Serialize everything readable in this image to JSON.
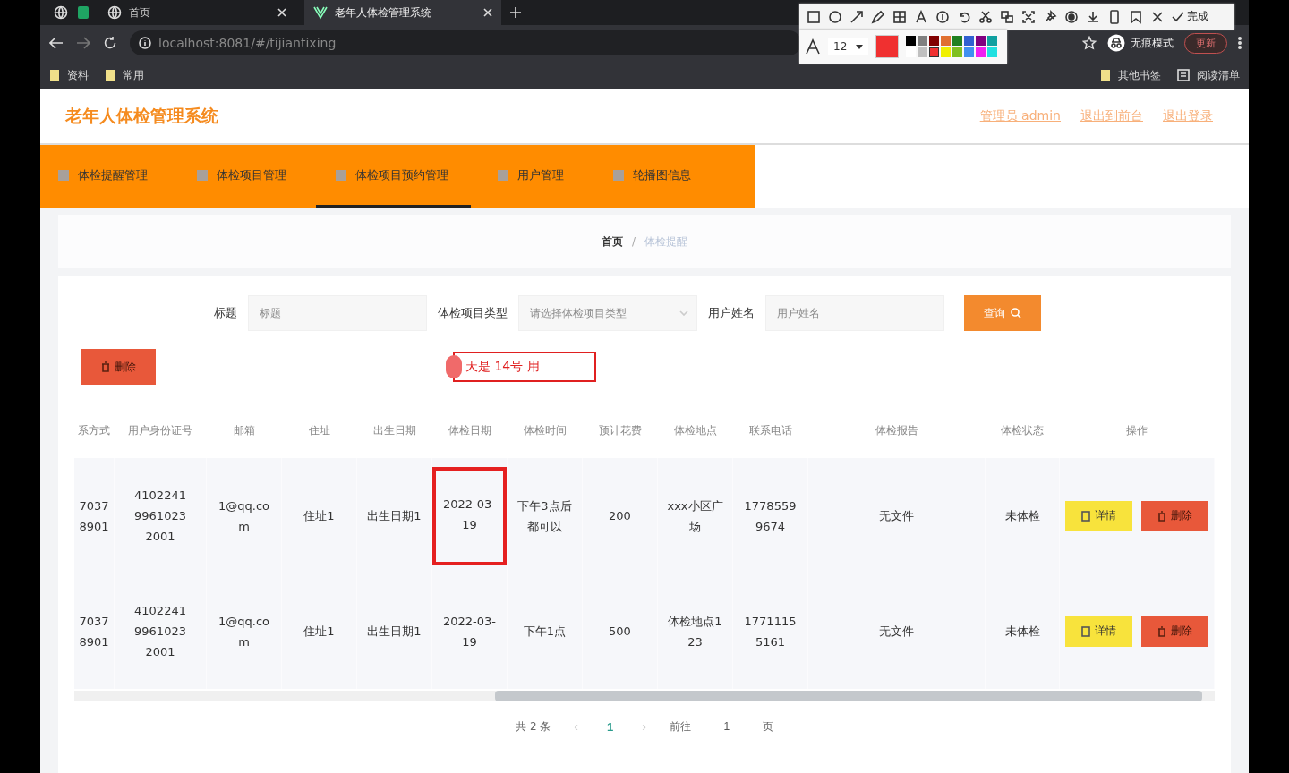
{
  "browser": {
    "tabs": [
      {
        "title": "首页",
        "selected": false
      },
      {
        "title": "老年人体检管理系统",
        "selected": true
      }
    ],
    "url": "localhost:8081/#/tijiantixing",
    "bookmarks": [
      "资料",
      "常用"
    ],
    "right_bookmarks": [
      "其他书签",
      "阅读清单"
    ],
    "incognito": "无痕模式",
    "update_button": "更新"
  },
  "annotation_toolbar": {
    "done": "完成",
    "font_size": "12",
    "swatches": [
      {
        "color": "#000000",
        "selected": false
      },
      {
        "color": "#808080",
        "selected": false
      },
      {
        "color": "#800000",
        "selected": false
      },
      {
        "color": "#e07030",
        "selected": false
      },
      {
        "color": "#208020",
        "selected": false
      },
      {
        "color": "#3060d0",
        "selected": false
      },
      {
        "color": "#800080",
        "selected": false
      },
      {
        "color": "#10a0a0",
        "selected": false
      },
      {
        "color": "#ffffff",
        "selected": false
      },
      {
        "color": "#c0c0c0",
        "selected": false
      },
      {
        "color": "#f03030",
        "selected": true
      },
      {
        "color": "#f0f000",
        "selected": false
      },
      {
        "color": "#80c020",
        "selected": false
      },
      {
        "color": "#4090f0",
        "selected": false
      },
      {
        "color": "#f020f0",
        "selected": false
      },
      {
        "color": "#20e0e0",
        "selected": false
      }
    ]
  },
  "app": {
    "title": "老年人体检管理系统",
    "header_links": [
      "管理员 admin",
      "退出到前台",
      "退出登录"
    ],
    "nav": [
      {
        "label": "体检提醒管理",
        "selected": false
      },
      {
        "label": "体检项目管理",
        "selected": false
      },
      {
        "label": "体检项目预约管理",
        "selected": true
      },
      {
        "label": "用户管理",
        "selected": false
      },
      {
        "label": "轮播图信息",
        "selected": false
      }
    ],
    "breadcrumb": [
      "首页",
      "体检提醒"
    ],
    "breadcrumb_separator": "/",
    "filters": [
      {
        "label": "标题",
        "placeholder": "标题",
        "kind": "text"
      },
      {
        "label": "体检项目类型",
        "placeholder": "请选择体检项目类型",
        "kind": "select"
      },
      {
        "label": "用户姓名",
        "placeholder": "用户姓名",
        "kind": "text"
      }
    ],
    "search_button": "查询",
    "delete_button": "删除",
    "annotation_text": "天是 14号 用",
    "table": {
      "columns": [
        "系方式",
        "用户身份证号",
        "邮箱",
        "住址",
        "出生日期",
        "体检日期",
        "体检时间",
        "预计花费",
        "体检地点",
        "联系电话",
        "体检报告",
        "体检状态",
        "操作"
      ],
      "rows": [
        {
          "cells": [
            "70378901",
            "410224199610232001",
            "1@qq.com",
            "住址1",
            "出生日期1",
            "2022-03-19",
            "下午3点后都可以",
            "200",
            "xxx小区广场",
            "17785599674",
            "无文件",
            "未体检"
          ],
          "highlighted": true,
          "actions": [
            "详情",
            "删除"
          ]
        },
        {
          "cells": [
            "70378901",
            "410224199610232001",
            "1@qq.com",
            "住址1",
            "出生日期1",
            "2022-03-19",
            "下午1点",
            "500",
            "体检地点123",
            "17711155161",
            "无文件",
            "未体检"
          ],
          "highlighted": false,
          "actions": [
            "详情",
            "删除"
          ]
        }
      ]
    },
    "pagination": {
      "total": "共 2 条",
      "prev": "‹",
      "pages": [
        {
          "label": "1",
          "selected": true
        }
      ],
      "next": "›",
      "goto": "前往",
      "page_input": "1",
      "page_suffix": "页"
    }
  }
}
